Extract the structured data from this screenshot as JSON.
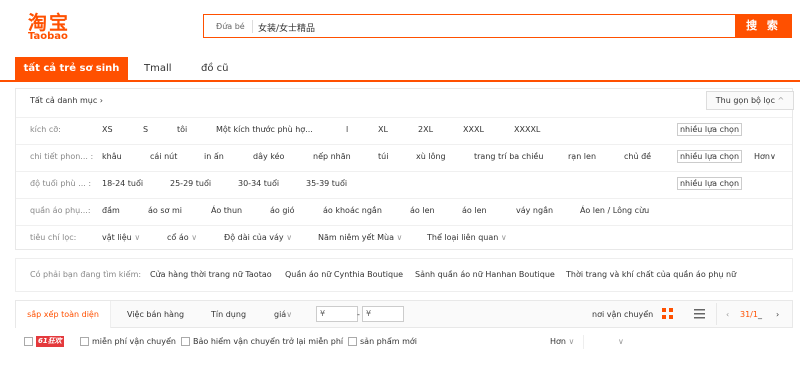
{
  "logo": {
    "cn": "淘宝",
    "en": "Taobao"
  },
  "search": {
    "scope": "Đứa bé",
    "query": "女装/女士精品",
    "button": "搜 索"
  },
  "tabs": [
    {
      "label": "tất cả trẻ sơ sinh"
    },
    {
      "label": "Tmall"
    },
    {
      "label": "đồ cũ"
    }
  ],
  "filter": {
    "breadcrumb": "Tất cả danh mục",
    "collapse_label": "Thu gọn bộ lọc",
    "multi_select": "nhiều lựa chọn",
    "more": "Hơn",
    "size": {
      "label": "kích cỡ:",
      "options": [
        "XS",
        "S",
        "tôi",
        "Một kích thước phù hợ...",
        "l",
        "XL",
        "2XL",
        "XXXL",
        "XXXXL"
      ]
    },
    "detail": {
      "label": "chi tiết phon... :",
      "options": [
        "khâu",
        "cái nút",
        "in ấn",
        "dây kéo",
        "nếp nhăn",
        "túi",
        "xù lông",
        "trang trí ba chiều",
        "rạn len",
        "chủ đề"
      ]
    },
    "age": {
      "label": "độ tuổi phù ... :",
      "options": [
        "18-24 tuổi",
        "25-29 tuổi",
        "30-34 tuổi",
        "35-39 tuổi"
      ]
    },
    "apparel": {
      "label": "quần áo phụ...:",
      "options": [
        "đầm",
        "áo sơ mi",
        "Áo thun",
        "áo gió",
        "áo khoác ngắn",
        "áo len",
        "áo len",
        "váy ngắn",
        "Áo len / Lông cừu"
      ]
    },
    "criteria": {
      "label": "tiêu chí lọc:",
      "options": [
        "vật liệu",
        "cổ áo",
        "Độ dài của váy",
        "Năm niêm yết Mùa",
        "Thể loại liên quan"
      ]
    }
  },
  "related": {
    "label": "Có phải bạn đang tìm kiếm:",
    "links": [
      "Cửa hàng thời trang nữ Taotao",
      "Quần áo nữ Cynthia Boutique",
      "Sảnh quần áo nữ Hanhan Boutique",
      "Thời trang và khí chất của quần áo phụ nữ"
    ]
  },
  "sort": {
    "active": "sắp xếp toàn diện",
    "items": [
      "Việc bán hàng",
      "Tín dụng",
      "giá"
    ],
    "price_min_placeholder": "¥",
    "price_max_placeholder": "¥",
    "price_dash": "-",
    "shipping": "nơi vận chuyển",
    "page": "31/1",
    "page_suffix": "_"
  },
  "checks": {
    "badge": "61狂欢",
    "items": [
      "miễn phí vận chuyển",
      "Bảo hiểm vận chuyển trở lại miễn phí",
      "sản phẩm mới"
    ],
    "more": "Hơn"
  },
  "colors": {
    "brand": "#ff5000",
    "badge": "#e4393c"
  }
}
